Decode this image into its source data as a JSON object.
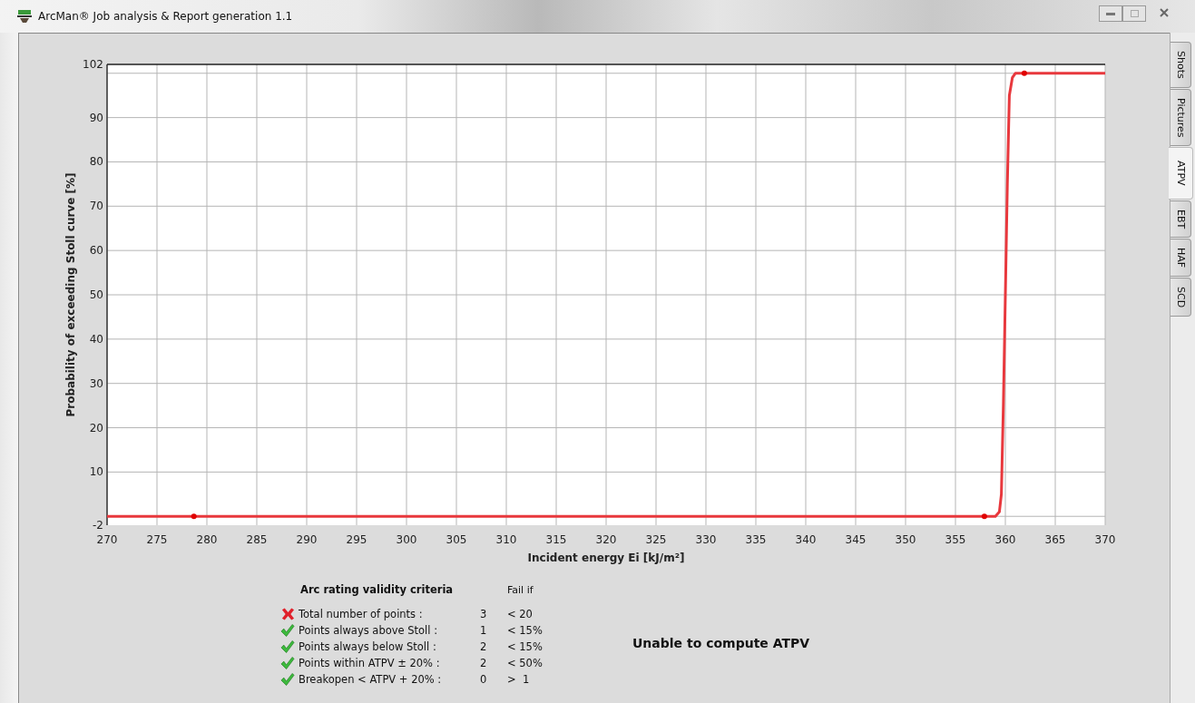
{
  "window": {
    "title": "ArcMan® Job analysis & Report generation 1.1"
  },
  "tabs": [
    {
      "label": "Shots",
      "selected": false
    },
    {
      "label": "Pictures",
      "selected": false
    },
    {
      "label": "ATPV",
      "selected": true
    },
    {
      "label": "EBT",
      "selected": false
    },
    {
      "label": "HAF",
      "selected": false
    },
    {
      "label": "SCD",
      "selected": false
    }
  ],
  "chart": {
    "chart_data": {
      "type": "line",
      "xlabel": "Incident energy Ei [kJ/m²]",
      "ylabel": "Probability of exceeding Stoll curve [%]",
      "x": [
        270,
        278.7,
        320,
        357.9,
        359.0,
        359.4,
        359.6,
        359.8,
        360.0,
        360.2,
        360.4,
        360.7,
        361.0,
        361.9,
        370
      ],
      "series": [
        {
          "color": "#e8383d",
          "values": [
            0,
            0,
            0,
            0,
            0,
            1,
            5,
            25,
            50,
            75,
            95,
            99,
            100,
            100,
            100
          ]
        },
        {
          "type": "scatter",
          "color": "#e00000",
          "values": [
            null,
            0,
            null,
            0,
            null,
            null,
            null,
            null,
            null,
            null,
            null,
            null,
            null,
            100,
            null
          ]
        }
      ],
      "grid": true,
      "xlim": [
        270,
        370
      ],
      "ylim": [
        -2,
        102
      ],
      "xticks": [
        270,
        275,
        280,
        285,
        290,
        295,
        300,
        305,
        310,
        315,
        320,
        325,
        330,
        335,
        340,
        345,
        350,
        355,
        360,
        365,
        370
      ],
      "yticks": [
        -2,
        10,
        20,
        30,
        40,
        50,
        60,
        70,
        80,
        90,
        102
      ]
    }
  },
  "criteria": {
    "title": "Arc rating validity criteria",
    "fail_if_heading": "Fail if",
    "rows": [
      {
        "passed": false,
        "label": "Total number of points :",
        "value": "3",
        "threshold": "< 20"
      },
      {
        "passed": true,
        "label": "Points always above Stoll :",
        "value": "1",
        "threshold": "< 15%"
      },
      {
        "passed": true,
        "label": "Points always below Stoll :",
        "value": "2",
        "threshold": "< 15%"
      },
      {
        "passed": true,
        "label": "Points within ATPV ± 20% :",
        "value": "2",
        "threshold": "< 50%"
      },
      {
        "passed": true,
        "label": "Breakopen < ATPV + 20% :",
        "value": "0",
        "threshold": ">  1"
      }
    ],
    "result": "Unable to compute ATPV"
  }
}
